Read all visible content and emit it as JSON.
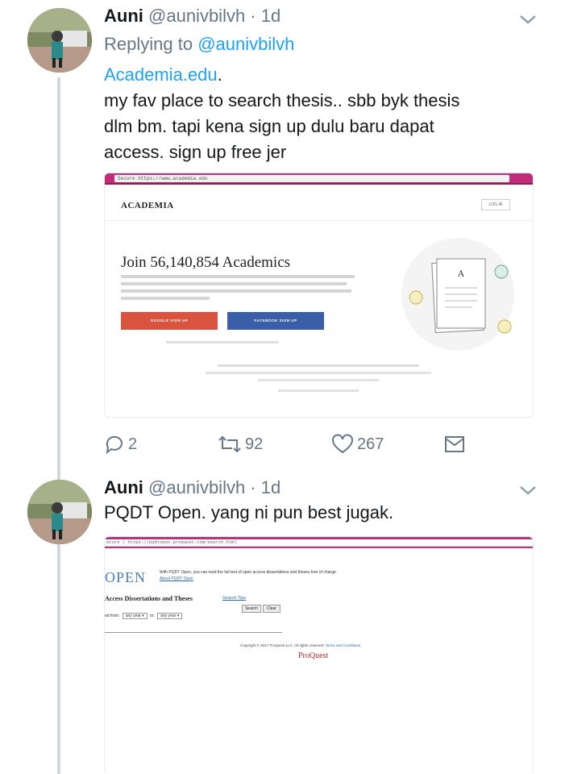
{
  "tweets": [
    {
      "author": {
        "name": "Auni",
        "handle": "@aunivbilvh"
      },
      "separator": "·",
      "time": "1d",
      "reply_prefix": "Replying to ",
      "reply_to": "@aunivbilvh",
      "link_text": "Academia.edu",
      "link_suffix": ".",
      "text_lines": [
        "my fav place to search thesis.. sbb byk thesis",
        "dlm bm. tapi kena sign up dulu baru dapat",
        "access. sign up free jer"
      ],
      "media": {
        "url": "Secure  https://www.academia.edu",
        "logo": "ACADEMIA",
        "login_button": "LOG IN",
        "headline": "Join 56,140,854 Academics",
        "google_button": "GOOGLE SIGN UP",
        "facebook_button": "FACEBOOK SIGN UP",
        "illustration_letter": "A"
      },
      "stats": {
        "replies": "2",
        "retweets": "92",
        "likes": "267"
      }
    },
    {
      "author": {
        "name": "Auni",
        "handle": "@aunivbilvh"
      },
      "separator": "·",
      "time": "1d",
      "text": "PQDT Open. yang ni pun best jugak.",
      "media": {
        "url": "ecure | https://pqdtopen.proquest.com/search.html",
        "open_logo": "OPEN",
        "intro": "With PQDT Open, you can read the full text of open access dissertations and theses free of charge.",
        "about_link": "About PQDT Open",
        "access_title": "Access Dissertations and Theses",
        "search_tips": "Search Tips",
        "search_button": "Search",
        "clear_button": "Clear",
        "filter_label": "ed from:",
        "year_from": "any year",
        "to_label": "to:",
        "year_to": "any year",
        "copyright": "Copyright © 2017 ProQuest LLC. All rights reserved.",
        "terms": "Terms and Conditions",
        "logo": "ProQuest"
      }
    }
  ],
  "colors": {
    "accent": "#1da1f2",
    "muted": "#657786",
    "thread": "#cfd9de"
  }
}
